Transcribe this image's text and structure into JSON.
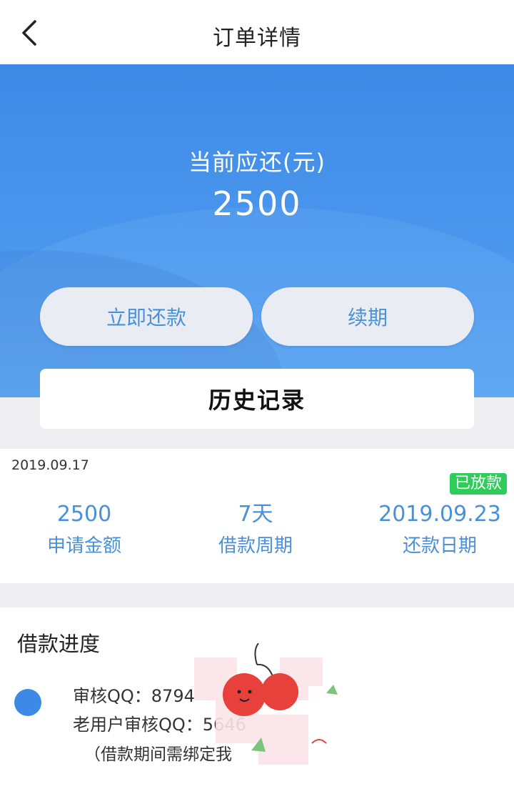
{
  "nav": {
    "title": "订单详情",
    "back_icon": "chevron-left-icon"
  },
  "hero": {
    "label": "当前应还(元)",
    "amount": "2500",
    "repay_button": "立即还款",
    "renew_button": "续期",
    "history_button": "历史记录",
    "colors": {
      "gradient_top": "#3d8ae6",
      "gradient_bottom": "#57a3f2",
      "button_text": "#4a90d9"
    }
  },
  "order": {
    "date": "2019.09.17",
    "status": "已放款",
    "status_color": "#2ecc5a",
    "stats": [
      {
        "value": "2500",
        "label": "申请金额"
      },
      {
        "value": "7天",
        "label": "借款周期"
      },
      {
        "value": "2019.09.23",
        "label": "还款日期"
      }
    ]
  },
  "progress": {
    "title": "借款进度",
    "lines": [
      "审核QQ：8794",
      "老用户审核QQ：5646",
      "（借款期间需绑定我"
    ],
    "dot_color": "#3d8ae6"
  }
}
